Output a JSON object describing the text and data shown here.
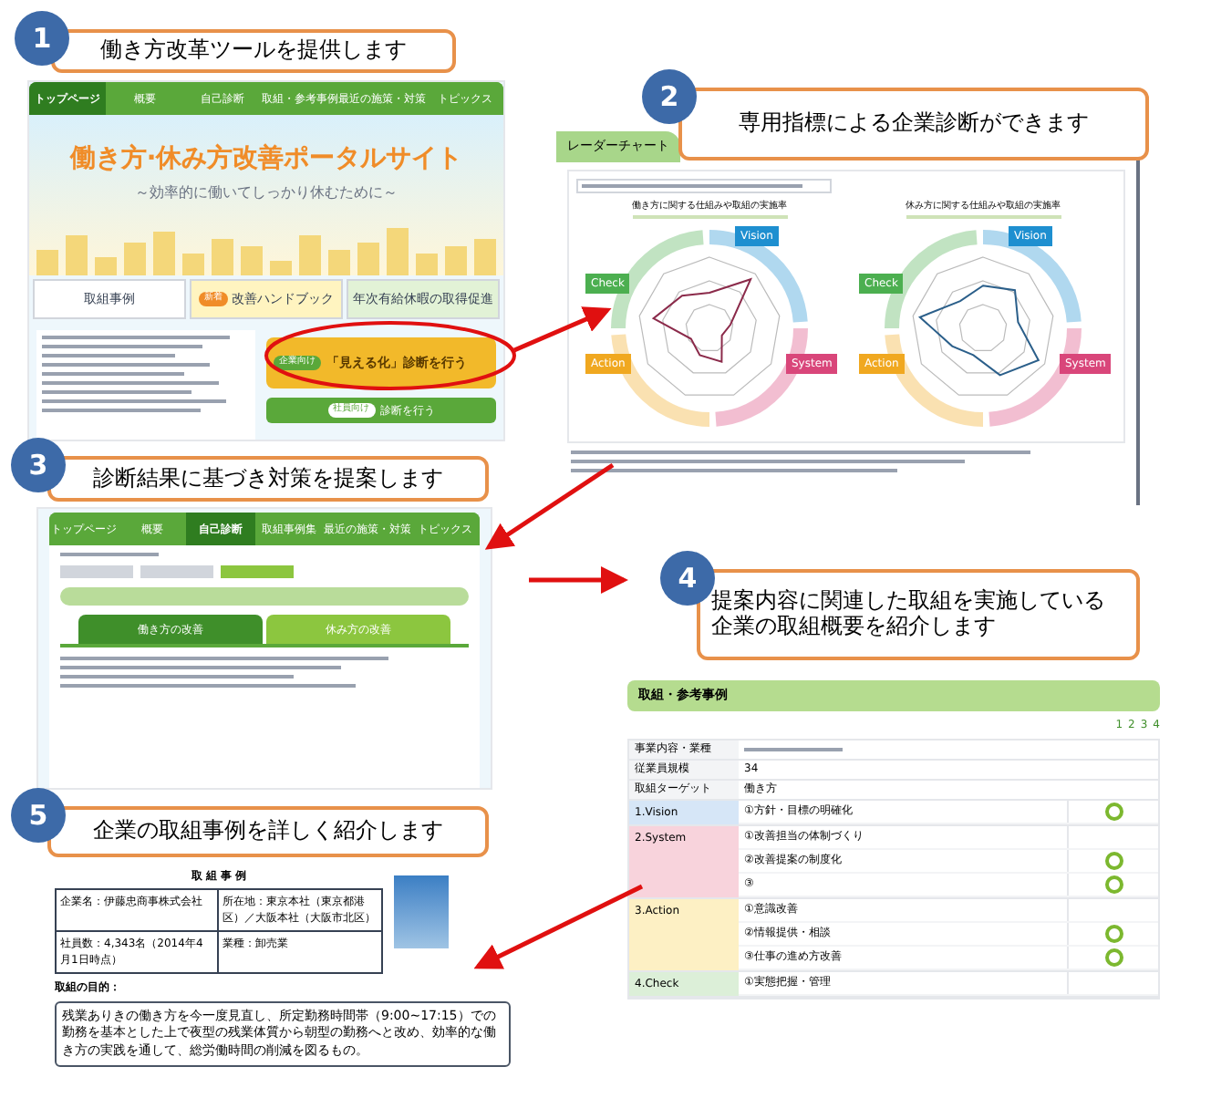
{
  "callouts": [
    {
      "number": "1",
      "text": "働き方改革ツールを提供します"
    },
    {
      "number": "2",
      "text": "専用指標による企業診断ができます"
    },
    {
      "number": "3",
      "text": "診断結果に基づき対策を提案します"
    },
    {
      "number": "4",
      "text": "提案内容に関連した取組を実施している企業の取組概要を紹介します"
    },
    {
      "number": "5",
      "text": "企業の取組事例を詳しく紹介します"
    }
  ],
  "portal_screen": {
    "nav": [
      {
        "label": "トップページ",
        "selected": true
      },
      {
        "label": "概要",
        "selected": false
      },
      {
        "label": "自己診断",
        "selected": false
      },
      {
        "label": "取組・参考事例",
        "selected": false
      },
      {
        "label": "最近の施策・対策",
        "selected": false
      },
      {
        "label": "トピックス",
        "selected": false
      }
    ],
    "title": "働き方·休み方改善ポータルサイト",
    "subtitle": "～効率的に働いてしっかり休むために～",
    "banners": [
      {
        "label": "取組事例"
      },
      {
        "badge": "新着",
        "label": "改善ハンドブック"
      },
      {
        "label": "年次有給休暇の取得促進"
      }
    ],
    "diagnosis_button": {
      "badge": "企業向け",
      "label": "「見える化」診断を行う"
    },
    "secondary_button": {
      "badge": "社員向け",
      "label": "診断を行う"
    }
  },
  "radar_screen": {
    "header": "レーダーチャート",
    "charts": [
      {
        "title": "働き方に関する仕組みや取組の実施率",
        "segments": [
          {
            "name": "Vision",
            "color": "#1e8fd0"
          },
          {
            "name": "System",
            "color": "#d9467a"
          },
          {
            "name": "Action",
            "color": "#f0a820"
          },
          {
            "name": "Check",
            "color": "#4caf50"
          }
        ]
      },
      {
        "title": "休み方に関する仕組みや取組の実施率",
        "segments": [
          {
            "name": "Vision",
            "color": "#1e8fd0"
          },
          {
            "name": "System",
            "color": "#d9467a"
          },
          {
            "name": "Action",
            "color": "#f0a820"
          },
          {
            "name": "Check",
            "color": "#4caf50"
          }
        ]
      }
    ]
  },
  "proposal_screen": {
    "nav": [
      {
        "label": "トップページ",
        "selected": false
      },
      {
        "label": "概要",
        "selected": false
      },
      {
        "label": "自己診断",
        "selected": true
      },
      {
        "label": "取組事例集",
        "selected": false
      },
      {
        "label": "最近の施策・対策",
        "selected": false
      },
      {
        "label": "トピックス",
        "selected": false
      }
    ],
    "steps": [
      {
        "selected": false
      },
      {
        "selected": false
      },
      {
        "selected": true
      }
    ],
    "tabs": [
      {
        "label": "働き方の改善",
        "selected": true
      },
      {
        "label": "休み方の改善",
        "selected": false
      }
    ]
  },
  "case_screen": {
    "header": "取組・参考事例",
    "pages": [
      "1",
      "2",
      "3",
      "4"
    ],
    "overview_rows": [
      {
        "label": "事業内容・業種"
      },
      {
        "label": "従業員規模",
        "value": "34"
      },
      {
        "label": "取組ターゲット",
        "value": "働き方"
      }
    ],
    "categories": [
      {
        "name": "1.Vision",
        "color": "#d6e6f7",
        "items": [
          {
            "text": "①方針・目標の明確化",
            "done": true
          }
        ]
      },
      {
        "name": "2.System",
        "color": "#f8d3dc",
        "items": [
          {
            "text": "①改善担当の体制づくり",
            "done": false
          },
          {
            "text": "②改善提案の制度化",
            "done": true
          },
          {
            "text": "③",
            "done": true
          }
        ]
      },
      {
        "name": "3.Action",
        "color": "#fdf0c4",
        "items": [
          {
            "text": "①意識改善",
            "done": false
          },
          {
            "text": "②情報提供・相談",
            "done": true
          },
          {
            "text": "③仕事の進め方改善",
            "done": true
          }
        ]
      },
      {
        "name": "4.Check",
        "color": "#dcefd8",
        "items": [
          {
            "text": "①実態把握・管理",
            "done": false
          }
        ]
      }
    ]
  },
  "case_document": {
    "title": "取 組 事 例",
    "company": "企業名：伊藤忠商事株式会社",
    "location": "所在地：東京本社（東京都港区）／大阪本社（大阪市北区）",
    "employees": "社員数：4,343名（2014年4月1日時点）",
    "industry": "業種：卸売業",
    "purpose_label": "取組の目的：",
    "purpose": "残業ありきの働き方を今一度見直し、所定勤務時間帯（9:00~17:15）での勤務を基本とした上で夜型の残業体質から朝型の勤務へと改め、効率的な働き方の実践を通して、総労働時間の削減を図るもの。"
  }
}
